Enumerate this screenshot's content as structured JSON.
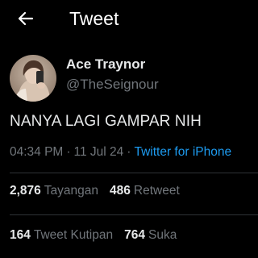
{
  "header": {
    "title": "Tweet",
    "back_icon": "arrow-left-icon"
  },
  "author": {
    "display_name": "Ace Traynor",
    "handle": "@TheSeignour",
    "avatar": "profile-photo"
  },
  "tweet": {
    "text": "NANYA LAGI GAMPAR NIH",
    "time": "04:34 PM",
    "separator": "·",
    "date": "11 Jul 24",
    "source": "Twitter for iPhone"
  },
  "stats": {
    "views": {
      "count": "2,876",
      "label": "Tayangan"
    },
    "retweets": {
      "count": "486",
      "label": "Retweet"
    },
    "quotes": {
      "count": "164",
      "label": "Tweet Kutipan"
    },
    "likes": {
      "count": "764",
      "label": "Suka"
    }
  },
  "colors": {
    "background": "#000000",
    "text": "#e7e9ea",
    "secondary": "#71767b",
    "link": "#1d9bf0",
    "divider": "#2f3336"
  }
}
